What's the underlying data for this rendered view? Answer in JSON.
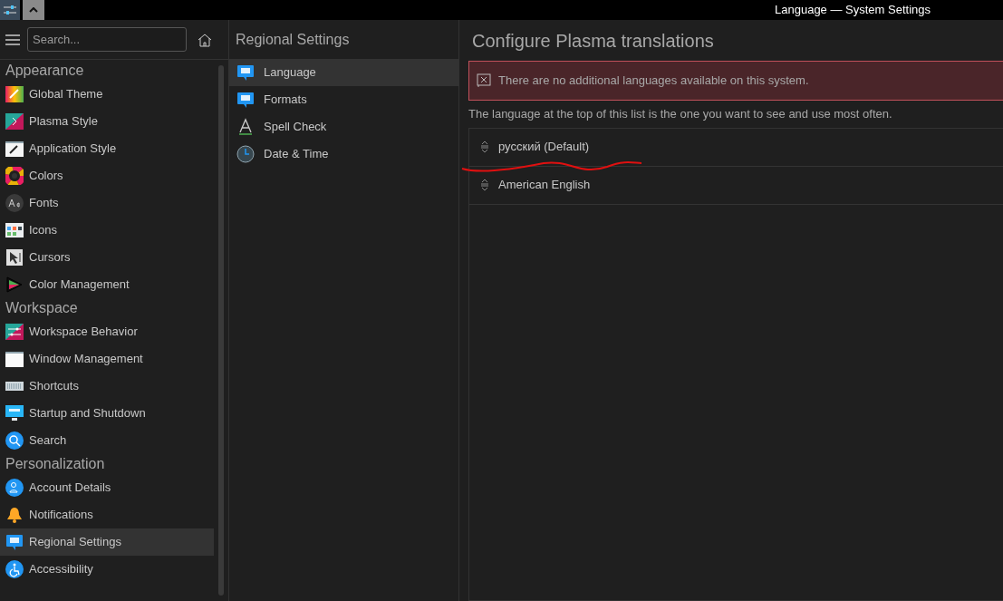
{
  "window": {
    "title": "Language — System Settings"
  },
  "search": {
    "placeholder": "Search..."
  },
  "sidebar": {
    "sections": [
      {
        "heading": "Appearance",
        "items": [
          {
            "label": "Global Theme",
            "selected": false
          },
          {
            "label": "Plasma Style",
            "selected": false
          },
          {
            "label": "Application Style",
            "selected": false
          },
          {
            "label": "Colors",
            "selected": false
          },
          {
            "label": "Fonts",
            "selected": false
          },
          {
            "label": "Icons",
            "selected": false
          },
          {
            "label": "Cursors",
            "selected": false
          },
          {
            "label": "Color Management",
            "selected": false
          }
        ]
      },
      {
        "heading": "Workspace",
        "items": [
          {
            "label": "Workspace Behavior",
            "selected": false
          },
          {
            "label": "Window Management",
            "selected": false
          },
          {
            "label": "Shortcuts",
            "selected": false
          },
          {
            "label": "Startup and Shutdown",
            "selected": false
          },
          {
            "label": "Search",
            "selected": false
          }
        ]
      },
      {
        "heading": "Personalization",
        "items": [
          {
            "label": "Account Details",
            "selected": false
          },
          {
            "label": "Notifications",
            "selected": false
          },
          {
            "label": "Regional Settings",
            "selected": true
          },
          {
            "label": "Accessibility",
            "selected": false
          }
        ]
      }
    ]
  },
  "subpanel": {
    "title": "Regional Settings",
    "items": [
      {
        "label": "Language",
        "selected": true
      },
      {
        "label": "Formats",
        "selected": false
      },
      {
        "label": "Spell Check",
        "selected": false
      },
      {
        "label": "Date & Time",
        "selected": false
      }
    ]
  },
  "content": {
    "title": "Configure Plasma translations",
    "error": "There are no additional languages available on this system.",
    "hint": "The language at the top of this list is the one you want to see and use most often.",
    "languages": [
      "русский (Default)",
      "American English"
    ]
  }
}
